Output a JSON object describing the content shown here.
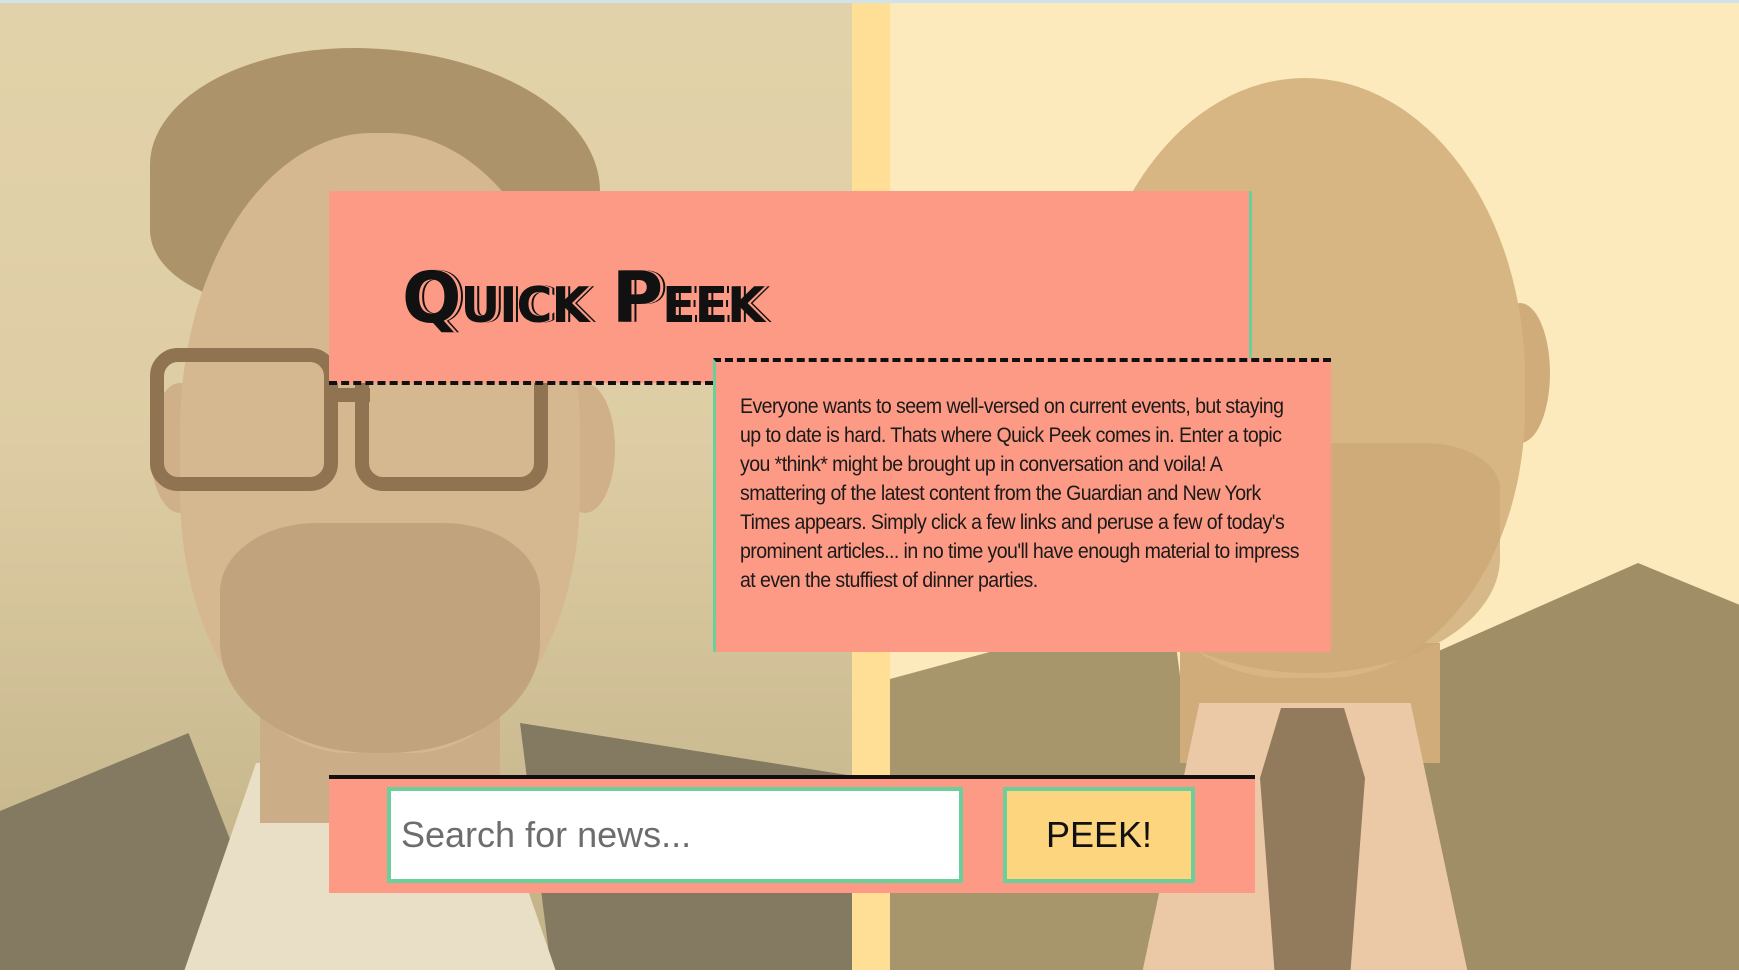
{
  "app": {
    "logo_text": "Quick Peek"
  },
  "intro": {
    "description": "Everyone wants to seem well-versed on current events, but staying up to date is hard. Thats where Quick Peek comes in. Enter a topic you *think* might be brought up in conversation and voila! A smattering of the latest content from the Guardian and New York Times appears. Simply click a few links and peruse a few of today's prominent articles... in no time you'll have enough material to impress at even the stuffiest of dinner parties."
  },
  "search": {
    "placeholder": "Search for news...",
    "value": "",
    "button_label": "PEEK!"
  },
  "colors": {
    "card": "#fd9a85",
    "accent_border": "#6bcf9c",
    "button": "#fdd57e",
    "stripe": "#fedf95"
  }
}
